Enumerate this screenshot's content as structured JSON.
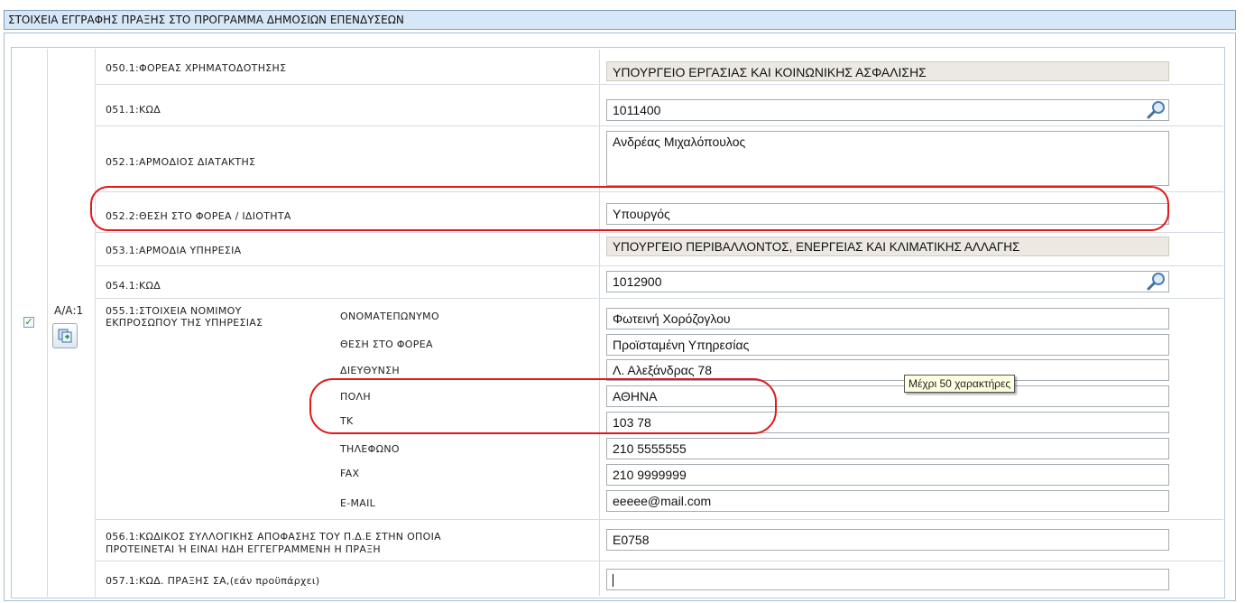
{
  "section_title": "ΣΤΟΙΧΕΙΑ ΕΓΓΡΑΦΗΣ ΠΡΑΞΗΣ ΣΤΟ ΠΡΟΓΡΑΜΜΑ ΔΗΜΟΣΙΩΝ ΕΠΕΝΔΥΣΕΩΝ",
  "record": {
    "aa_label": "Α/Α:1",
    "selected": true
  },
  "fields": {
    "f050_1": {
      "label": "050.1:ΦΟΡΕΑΣ ΧΡΗΜΑΤΟΔΟΤΗΣΗΣ",
      "value": "ΥΠΟΥΡΓΕΙΟ ΕΡΓΑΣΙΑΣ ΚΑΙ ΚΟΙΝΩΝΙΚΗΣ ΑΣΦΑΛΙΣΗΣ"
    },
    "f051_1": {
      "label": "051.1:ΚΩΔ",
      "value": "1011400"
    },
    "f052_1": {
      "label": "052.1:ΑΡΜΟΔΙΟΣ ΔΙΑΤΑΚΤΗΣ",
      "value": "Ανδρέας Μιχαλόπουλος"
    },
    "f052_2": {
      "label": "052.2:ΘΕΣΗ ΣΤΟ ΦΟΡΕΑ / ΙΔΙΟΤΗΤΑ",
      "value": "Υπουργός"
    },
    "f053_1": {
      "label": "053.1:ΑΡΜΟΔΙΑ ΥΠΗΡΕΣΙΑ",
      "value": "ΥΠΟΥΡΓΕΙΟ  ΠΕΡΙΒΑΛΛΟΝΤΟΣ, ΕΝΕΡΓΕΙΑΣ ΚΑΙ ΚΛΙΜΑΤΙΚΗΣ ΑΛΛΑΓΗΣ"
    },
    "f054_1": {
      "label": "054.1:ΚΩΔ",
      "value": "1012900"
    },
    "f055_1": {
      "label_line1": "055.1:ΣΤΟΙΧΕΙΑ ΝΟΜΙΜΟΥ",
      "label_line2": "ΕΚΠΡΟΣΩΠΟΥ ΤΗΣ ΥΠΗΡΕΣΙΑΣ",
      "name_label": "ΟΝΟΜΑΤΕΠΩΝΥΜΟ",
      "name_value": "Φωτεινή Χορόζογλου",
      "position_label": "ΘΕΣΗ ΣΤΟ ΦΟΡΕΑ",
      "position_value": "Προϊσταμένη Υπηρεσίας",
      "address_label": "ΔΙΕΥΘΥΝΣΗ",
      "address_value": "Λ. Αλεξάνδρας 78",
      "city_label": "ΠΟΛΗ",
      "city_value": "ΑΘΗΝΑ",
      "zip_label": "ΤΚ",
      "zip_value": "103 78",
      "phone_label": "ΤΗΛΕΦΩΝΟ",
      "phone_value": "210 5555555",
      "fax_label": "FAX",
      "fax_value": "210 9999999",
      "email_label": "E-MAIL",
      "email_value": "eeeee@mail.com"
    },
    "f056_1": {
      "label_line1": "056.1:ΚΩΔΙΚΟΣ ΣΥΛΛΟΓΙΚΗΣ ΑΠΟΦΑΣΗΣ ΤΟΥ Π.Δ.Ε ΣΤΗΝ ΟΠΟΙΑ",
      "label_line2": "ΠΡΟΤΕΙΝΕΤΑΙ Ή ΕΙΝΑΙ ΗΔΗ ΕΓΓΕΓΡΑΜΜΕΝΗ Η ΠΡΑΞΗ",
      "value": "Ε0758"
    },
    "f057_1": {
      "label": "057.1:ΚΩΔ. ΠΡΑΞΗΣ ΣΑ,(εάν προϋπάρχει)",
      "value": ""
    }
  },
  "tooltip": "Μέχρι 50 χαρακτήρες",
  "icons": {
    "lookup": "magnifier-icon",
    "copy": "copy-record-icon",
    "checkbox": "checkmark-icon"
  },
  "colors": {
    "header_bg": "#d6e7f7",
    "highlight": "#e0191b",
    "readonly_bg": "#ece9e2",
    "tooltip_bg": "#ffffe1"
  }
}
